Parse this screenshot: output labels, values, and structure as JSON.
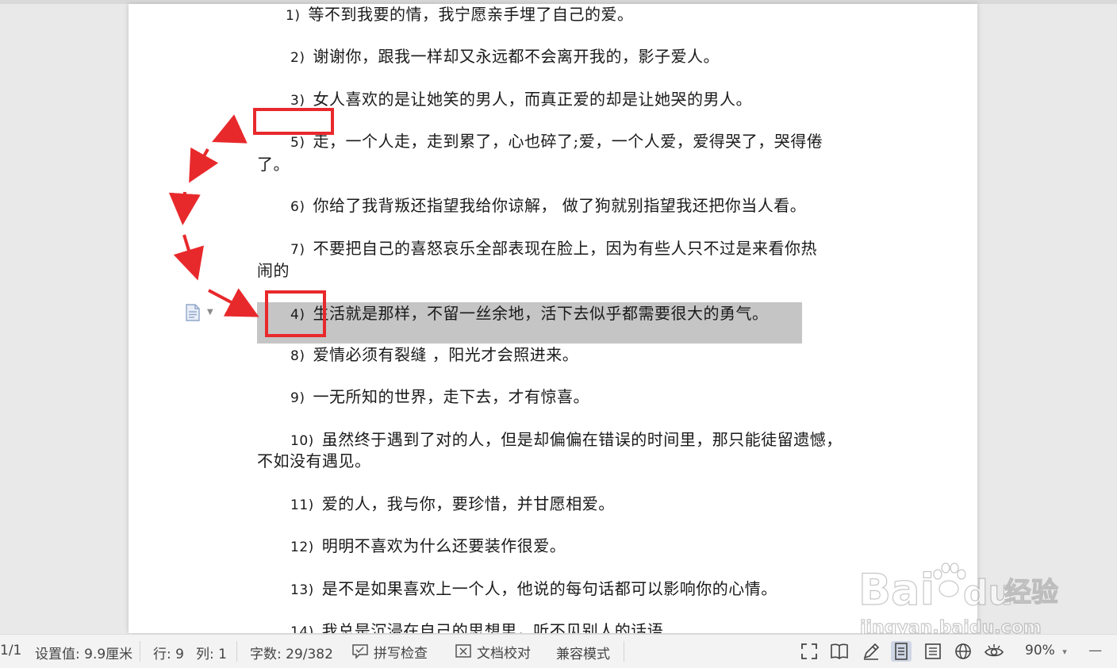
{
  "document": {
    "paragraphs": [
      {
        "num": "1)",
        "text": "等不到我要的情，我宁愿亲手埋了自己的爱。"
      },
      {
        "num": "2)",
        "text": "谢谢你，跟我一样却又永远都不会离开我的，影子爱人。"
      },
      {
        "num": "3)",
        "text": "女人喜欢的是让她笑的男人，而真正爱的却是让她哭的男人。"
      },
      {
        "num": "5)",
        "text": "走，一个人走，走到累了，心也碎了;爱，一个人爱，爱得哭了，哭得倦",
        "cont": "了。"
      },
      {
        "num": "6)",
        "text": "你给了我背叛还指望我给你谅解，  做了狗就别指望我还把你当人看。"
      },
      {
        "num": "7)",
        "text": "不要把自己的喜怒哀乐全部表现在脸上，因为有些人只不过是来看你热",
        "cont": "闹的"
      },
      {
        "num": "4)",
        "text": "生活就是那样，不留一丝余地，活下去似乎都需要很大的勇气。"
      },
      {
        "num": "8)",
        "text": "爱情必须有裂缝 ，阳光才会照进来。"
      },
      {
        "num": "9)",
        "text": "一无所知的世界，走下去，才有惊喜。"
      },
      {
        "num": "10)",
        "text": "虽然终于遇到了对的人，但是却偏偏在错误的时间里，那只能徒留遗憾，",
        "cont": "不如没有遇见。"
      },
      {
        "num": "11)",
        "text": "爱的人，我与你，要珍惜，并甘愿相爱。"
      },
      {
        "num": "12)",
        "text": "明明不喜欢为什么还要装作很爱。"
      },
      {
        "num": "13)",
        "text": "是不是如果喜欢上一个人，他说的每句话都可以影响你的心情。"
      },
      {
        "num": "14)",
        "text": "我总是沉浸在自己的思想里，听不见别人的话语"
      }
    ]
  },
  "statusbar": {
    "page": "1/1",
    "setting": "设置值: 9.9厘米",
    "row": "行: 9",
    "col": "列: 1",
    "wordcount": "字数: 29/382",
    "spellcheck": "拼写检查",
    "proofread": "文档校对",
    "compat": "兼容模式",
    "zoom": "90%",
    "zoom_caret": "▾",
    "zoom_minus": "—"
  },
  "watermark": {
    "brand": "Bai",
    "brand_du": "du",
    "brand_cn": "经验",
    "site": "jingyan.baidu.com"
  },
  "colors": {
    "annotation_red": "#e8292c",
    "selection_gray": "#c5c5c5"
  },
  "icons": [
    "document-icon",
    "fullscreen-icon",
    "book-icon",
    "pen-icon",
    "page-view-icon",
    "outline-icon",
    "web-icon",
    "eye-icon"
  ]
}
